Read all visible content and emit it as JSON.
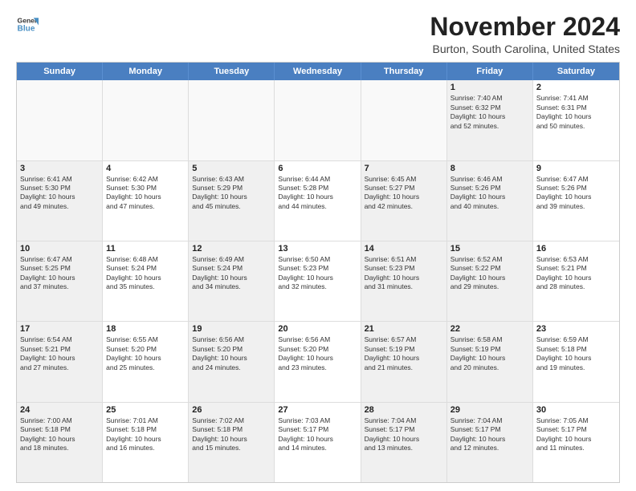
{
  "logo": {
    "line1": "General",
    "line2": "Blue",
    "icon": "🔵"
  },
  "title": "November 2024",
  "subtitle": "Burton, South Carolina, United States",
  "header": {
    "days": [
      "Sunday",
      "Monday",
      "Tuesday",
      "Wednesday",
      "Thursday",
      "Friday",
      "Saturday"
    ]
  },
  "weeks": [
    {
      "cells": [
        {
          "num": "",
          "info": "",
          "empty": true
        },
        {
          "num": "",
          "info": "",
          "empty": true
        },
        {
          "num": "",
          "info": "",
          "empty": true
        },
        {
          "num": "",
          "info": "",
          "empty": true
        },
        {
          "num": "",
          "info": "",
          "empty": true
        },
        {
          "num": "1",
          "info": "Sunrise: 7:40 AM\nSunset: 6:32 PM\nDaylight: 10 hours\nand 52 minutes.",
          "shaded": true
        },
        {
          "num": "2",
          "info": "Sunrise: 7:41 AM\nSunset: 6:31 PM\nDaylight: 10 hours\nand 50 minutes."
        }
      ]
    },
    {
      "cells": [
        {
          "num": "3",
          "info": "Sunrise: 6:41 AM\nSunset: 5:30 PM\nDaylight: 10 hours\nand 49 minutes.",
          "shaded": true
        },
        {
          "num": "4",
          "info": "Sunrise: 6:42 AM\nSunset: 5:30 PM\nDaylight: 10 hours\nand 47 minutes."
        },
        {
          "num": "5",
          "info": "Sunrise: 6:43 AM\nSunset: 5:29 PM\nDaylight: 10 hours\nand 45 minutes.",
          "shaded": true
        },
        {
          "num": "6",
          "info": "Sunrise: 6:44 AM\nSunset: 5:28 PM\nDaylight: 10 hours\nand 44 minutes."
        },
        {
          "num": "7",
          "info": "Sunrise: 6:45 AM\nSunset: 5:27 PM\nDaylight: 10 hours\nand 42 minutes.",
          "shaded": true
        },
        {
          "num": "8",
          "info": "Sunrise: 6:46 AM\nSunset: 5:26 PM\nDaylight: 10 hours\nand 40 minutes.",
          "shaded": true
        },
        {
          "num": "9",
          "info": "Sunrise: 6:47 AM\nSunset: 5:26 PM\nDaylight: 10 hours\nand 39 minutes."
        }
      ]
    },
    {
      "cells": [
        {
          "num": "10",
          "info": "Sunrise: 6:47 AM\nSunset: 5:25 PM\nDaylight: 10 hours\nand 37 minutes.",
          "shaded": true
        },
        {
          "num": "11",
          "info": "Sunrise: 6:48 AM\nSunset: 5:24 PM\nDaylight: 10 hours\nand 35 minutes."
        },
        {
          "num": "12",
          "info": "Sunrise: 6:49 AM\nSunset: 5:24 PM\nDaylight: 10 hours\nand 34 minutes.",
          "shaded": true
        },
        {
          "num": "13",
          "info": "Sunrise: 6:50 AM\nSunset: 5:23 PM\nDaylight: 10 hours\nand 32 minutes."
        },
        {
          "num": "14",
          "info": "Sunrise: 6:51 AM\nSunset: 5:23 PM\nDaylight: 10 hours\nand 31 minutes.",
          "shaded": true
        },
        {
          "num": "15",
          "info": "Sunrise: 6:52 AM\nSunset: 5:22 PM\nDaylight: 10 hours\nand 29 minutes.",
          "shaded": true
        },
        {
          "num": "16",
          "info": "Sunrise: 6:53 AM\nSunset: 5:21 PM\nDaylight: 10 hours\nand 28 minutes."
        }
      ]
    },
    {
      "cells": [
        {
          "num": "17",
          "info": "Sunrise: 6:54 AM\nSunset: 5:21 PM\nDaylight: 10 hours\nand 27 minutes.",
          "shaded": true
        },
        {
          "num": "18",
          "info": "Sunrise: 6:55 AM\nSunset: 5:20 PM\nDaylight: 10 hours\nand 25 minutes."
        },
        {
          "num": "19",
          "info": "Sunrise: 6:56 AM\nSunset: 5:20 PM\nDaylight: 10 hours\nand 24 minutes.",
          "shaded": true
        },
        {
          "num": "20",
          "info": "Sunrise: 6:56 AM\nSunset: 5:20 PM\nDaylight: 10 hours\nand 23 minutes."
        },
        {
          "num": "21",
          "info": "Sunrise: 6:57 AM\nSunset: 5:19 PM\nDaylight: 10 hours\nand 21 minutes.",
          "shaded": true
        },
        {
          "num": "22",
          "info": "Sunrise: 6:58 AM\nSunset: 5:19 PM\nDaylight: 10 hours\nand 20 minutes.",
          "shaded": true
        },
        {
          "num": "23",
          "info": "Sunrise: 6:59 AM\nSunset: 5:18 PM\nDaylight: 10 hours\nand 19 minutes."
        }
      ]
    },
    {
      "cells": [
        {
          "num": "24",
          "info": "Sunrise: 7:00 AM\nSunset: 5:18 PM\nDaylight: 10 hours\nand 18 minutes.",
          "shaded": true
        },
        {
          "num": "25",
          "info": "Sunrise: 7:01 AM\nSunset: 5:18 PM\nDaylight: 10 hours\nand 16 minutes."
        },
        {
          "num": "26",
          "info": "Sunrise: 7:02 AM\nSunset: 5:18 PM\nDaylight: 10 hours\nand 15 minutes.",
          "shaded": true
        },
        {
          "num": "27",
          "info": "Sunrise: 7:03 AM\nSunset: 5:17 PM\nDaylight: 10 hours\nand 14 minutes."
        },
        {
          "num": "28",
          "info": "Sunrise: 7:04 AM\nSunset: 5:17 PM\nDaylight: 10 hours\nand 13 minutes.",
          "shaded": true
        },
        {
          "num": "29",
          "info": "Sunrise: 7:04 AM\nSunset: 5:17 PM\nDaylight: 10 hours\nand 12 minutes.",
          "shaded": true
        },
        {
          "num": "30",
          "info": "Sunrise: 7:05 AM\nSunset: 5:17 PM\nDaylight: 10 hours\nand 11 minutes."
        }
      ]
    }
  ]
}
